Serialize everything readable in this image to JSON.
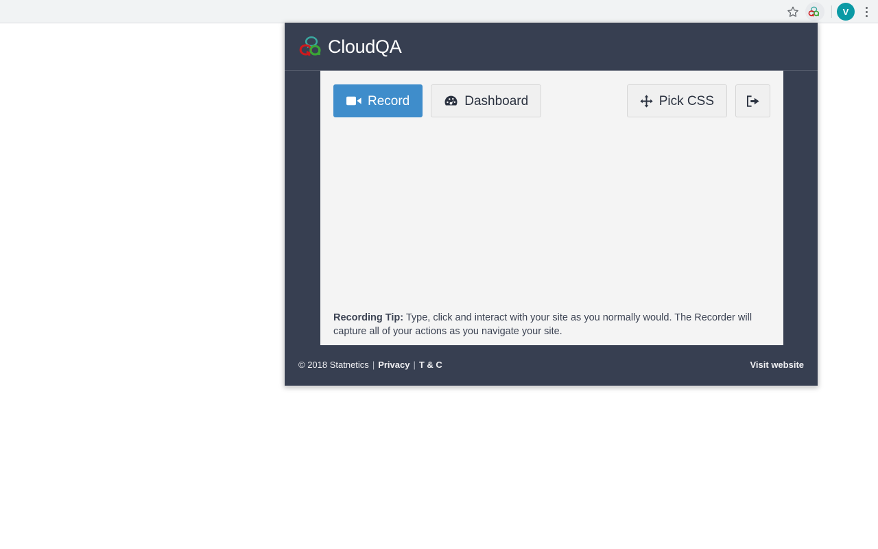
{
  "browser": {
    "toolbar": {
      "bookmark_icon": "star-icon",
      "extension_icon": "cloudqa-extension-icon",
      "profile_initial": "V",
      "menu_icon": "kebab-menu-icon"
    }
  },
  "popup": {
    "header": {
      "brand_name": "CloudQA",
      "logo_icon": "cloudqa-logo-icon",
      "logo_colors": {
        "bubble": "#3aa8a0",
        "q": "#d0191c",
        "a": "#3aa635"
      }
    },
    "buttons": {
      "record": {
        "label": "Record",
        "icon": "video-camera-icon"
      },
      "dashboard": {
        "label": "Dashboard",
        "icon": "tachometer-icon"
      },
      "pick_css": {
        "label": "Pick CSS",
        "icon": "arrows-alt-icon"
      },
      "logout": {
        "label": "",
        "icon": "sign-out-icon"
      }
    },
    "tip": {
      "label": "Recording Tip:",
      "text": "Type, click and interact with your site as you normally would. The Recorder will capture all of your actions as you navigate your site."
    },
    "footer": {
      "copyright": "© 2018 Statnetics",
      "separator": "|",
      "privacy": "Privacy",
      "terms": "T & C",
      "visit_website": "Visit website"
    }
  },
  "colors": {
    "dark_bg": "#373f51",
    "content_bg": "#f4f4f4",
    "primary": "#3f8dcb",
    "toolbar_bg": "#f1f3f4",
    "avatar_bg": "#0b9aa5"
  }
}
